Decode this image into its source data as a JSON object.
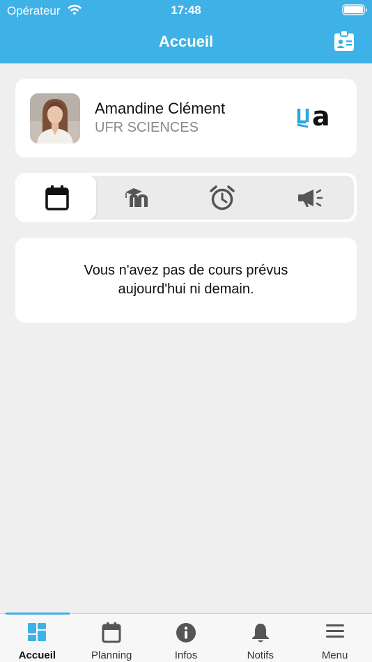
{
  "status_bar": {
    "carrier": "Opérateur",
    "time": "17:48"
  },
  "header": {
    "title": "Accueil",
    "badge_icon": "id-badge-icon"
  },
  "profile": {
    "name": "Amandine Clément",
    "organization": "UFR SCIENCES",
    "logo_text": "a"
  },
  "segments": [
    {
      "icon": "calendar-icon",
      "active": true
    },
    {
      "icon": "moodle-icon",
      "active": false
    },
    {
      "icon": "alarm-clock-icon",
      "active": false
    },
    {
      "icon": "megaphone-icon",
      "active": false
    }
  ],
  "message": "Vous n'avez pas de cours prévus aujourd'hui ni demain.",
  "tabs": [
    {
      "label": "Accueil",
      "icon": "dashboard-icon",
      "active": true
    },
    {
      "label": "Planning",
      "icon": "calendar-icon",
      "active": false
    },
    {
      "label": "Infos",
      "icon": "info-icon",
      "active": false
    },
    {
      "label": "Notifs",
      "icon": "bell-icon",
      "active": false
    },
    {
      "label": "Menu",
      "icon": "menu-icon",
      "active": false
    }
  ],
  "colors": {
    "accent": "#3eb1e6",
    "background": "#efefef",
    "icon_gray": "#555555"
  }
}
